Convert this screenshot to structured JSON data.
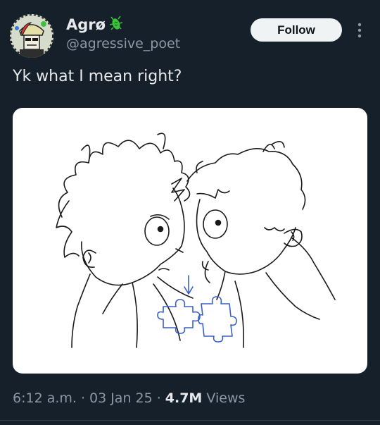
{
  "author": {
    "display_name": "Agrø",
    "handle": "@agressive_poet",
    "badge_icon": "green-bug-icon"
  },
  "follow_label": "Follow",
  "tweet": {
    "text": "Yk what I mean right?"
  },
  "meta": {
    "time": "6:12 a.m.",
    "sep1": "·",
    "date": "03 Jan 25",
    "sep2": "·",
    "views_count": "4.7M",
    "views_label": "Views"
  },
  "colors": {
    "background": "#15202b",
    "muted_text": "#8b98a5",
    "primary_text": "#e7e9ea",
    "follow_bg": "#eff3f4",
    "badge_green": "#3cc13b",
    "sketch_blue": "#3a5fc4"
  }
}
